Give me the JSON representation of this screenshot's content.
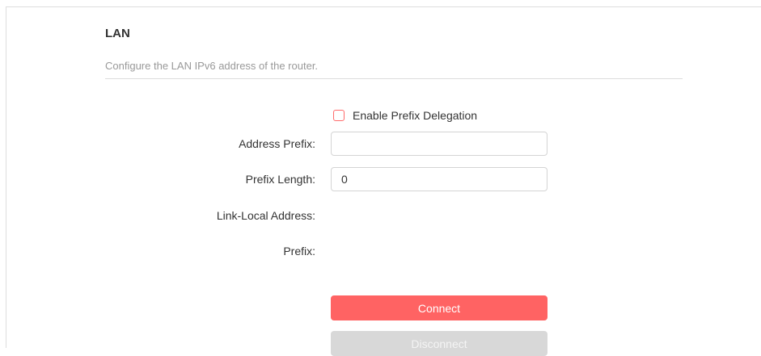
{
  "section": {
    "title": "LAN",
    "description": "Configure the LAN IPv6 address of the router."
  },
  "prefix_delegation": {
    "label": "Enable Prefix Delegation",
    "checked": false
  },
  "fields": {
    "address_prefix": {
      "label": "Address Prefix:",
      "value": ""
    },
    "prefix_length": {
      "label": "Prefix Length:",
      "value": "0"
    },
    "link_local_address": {
      "label": "Link-Local Address:",
      "value": ""
    },
    "prefix": {
      "label": "Prefix:",
      "value": ""
    }
  },
  "buttons": {
    "connect": "Connect",
    "disconnect": "Disconnect"
  },
  "colors": {
    "accent": "#ff6363",
    "checkbox_border": "#ff6b6b",
    "disabled": "#d8d8d8",
    "muted_text": "#999999",
    "text": "#333333"
  }
}
